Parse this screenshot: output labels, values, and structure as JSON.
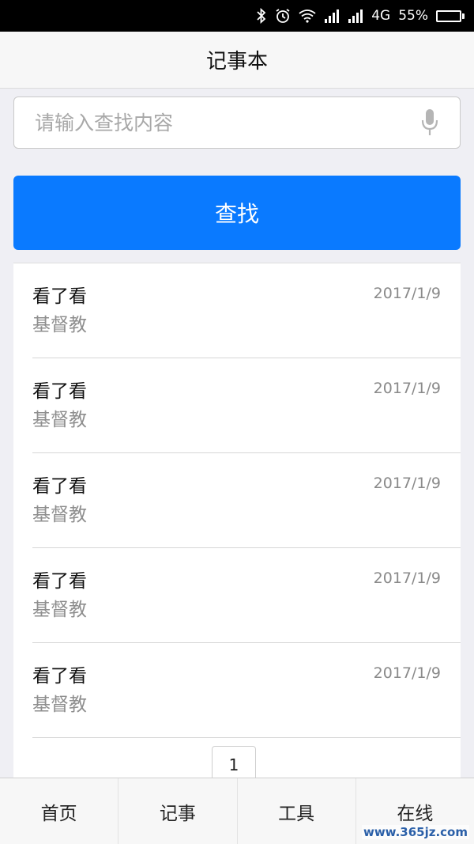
{
  "status_bar": {
    "network": "4G",
    "battery_text": "55%",
    "battery_level": 0.55,
    "icons": [
      "bluetooth-icon",
      "alarm-icon",
      "wifi-icon",
      "signal-icon",
      "signal-icon"
    ]
  },
  "header": {
    "title": "记事本"
  },
  "search": {
    "placeholder": "请输入查找内容",
    "value": "",
    "mic_icon": "microphone-icon",
    "button_label": "查找",
    "button_color": "#0a7aff"
  },
  "notes": [
    {
      "title": "看了看",
      "subtitle": "基督教",
      "date": "2017/1/9"
    },
    {
      "title": "看了看",
      "subtitle": "基督教",
      "date": "2017/1/9"
    },
    {
      "title": "看了看",
      "subtitle": "基督教",
      "date": "2017/1/9"
    },
    {
      "title": "看了看",
      "subtitle": "基督教",
      "date": "2017/1/9"
    },
    {
      "title": "看了看",
      "subtitle": "基督教",
      "date": "2017/1/9"
    }
  ],
  "pagination": {
    "current_page": "1"
  },
  "tabs": [
    {
      "label": "首页"
    },
    {
      "label": "记事"
    },
    {
      "label": "工具"
    },
    {
      "label": "在线"
    }
  ],
  "watermark": "www.365jz.com"
}
